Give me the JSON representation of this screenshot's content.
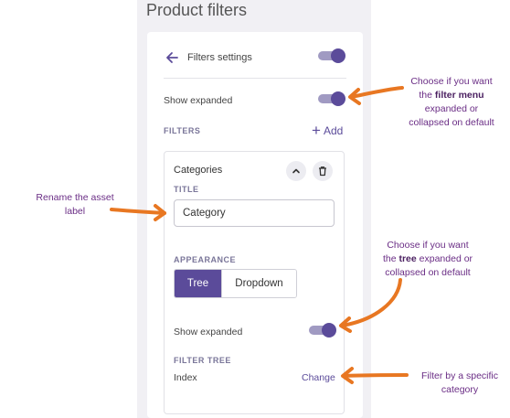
{
  "header": {
    "title": "Product filters"
  },
  "settings": {
    "label": "Filters settings",
    "back_icon": "arrow-left-icon",
    "enabled": true
  },
  "show_expanded": {
    "label": "Show expanded",
    "on": true
  },
  "filters_section": {
    "heading": "FILTERS",
    "add_label": "Add",
    "add_icon": "plus-icon"
  },
  "filter": {
    "name": "Categories",
    "collapse_icon": "chevron-up-icon",
    "delete_icon": "trash-icon",
    "title_heading": "TITLE",
    "title_value": "Category",
    "appearance_heading": "APPEARANCE",
    "appearance_options": [
      "Tree",
      "Dropdown"
    ],
    "appearance_selected": "Tree",
    "show_expanded_label": "Show expanded",
    "show_expanded_on": true,
    "tree_heading": "FILTER TREE",
    "tree_value": "Index",
    "change_label": "Change"
  },
  "annotations": {
    "filter_menu": {
      "line1": "Choose if you want",
      "line2_pre": "the ",
      "line2_bold": "filter menu",
      "line3": "expanded or",
      "line4": "collapsed on default"
    },
    "rename": {
      "line1": "Rename the asset",
      "line2": "label"
    },
    "tree": {
      "line1": "Choose if you want",
      "line2_pre": "the ",
      "line2_bold": "tree",
      "line2_post": " expanded or",
      "line3": "collapsed on default"
    },
    "category": {
      "line1": "Filter by a specific",
      "line2": "category"
    }
  },
  "colors": {
    "accent": "#5b4b9a",
    "annotation": "#6a2d85",
    "arrow": "#e87722",
    "panel_bg": "#f1f0f4"
  }
}
